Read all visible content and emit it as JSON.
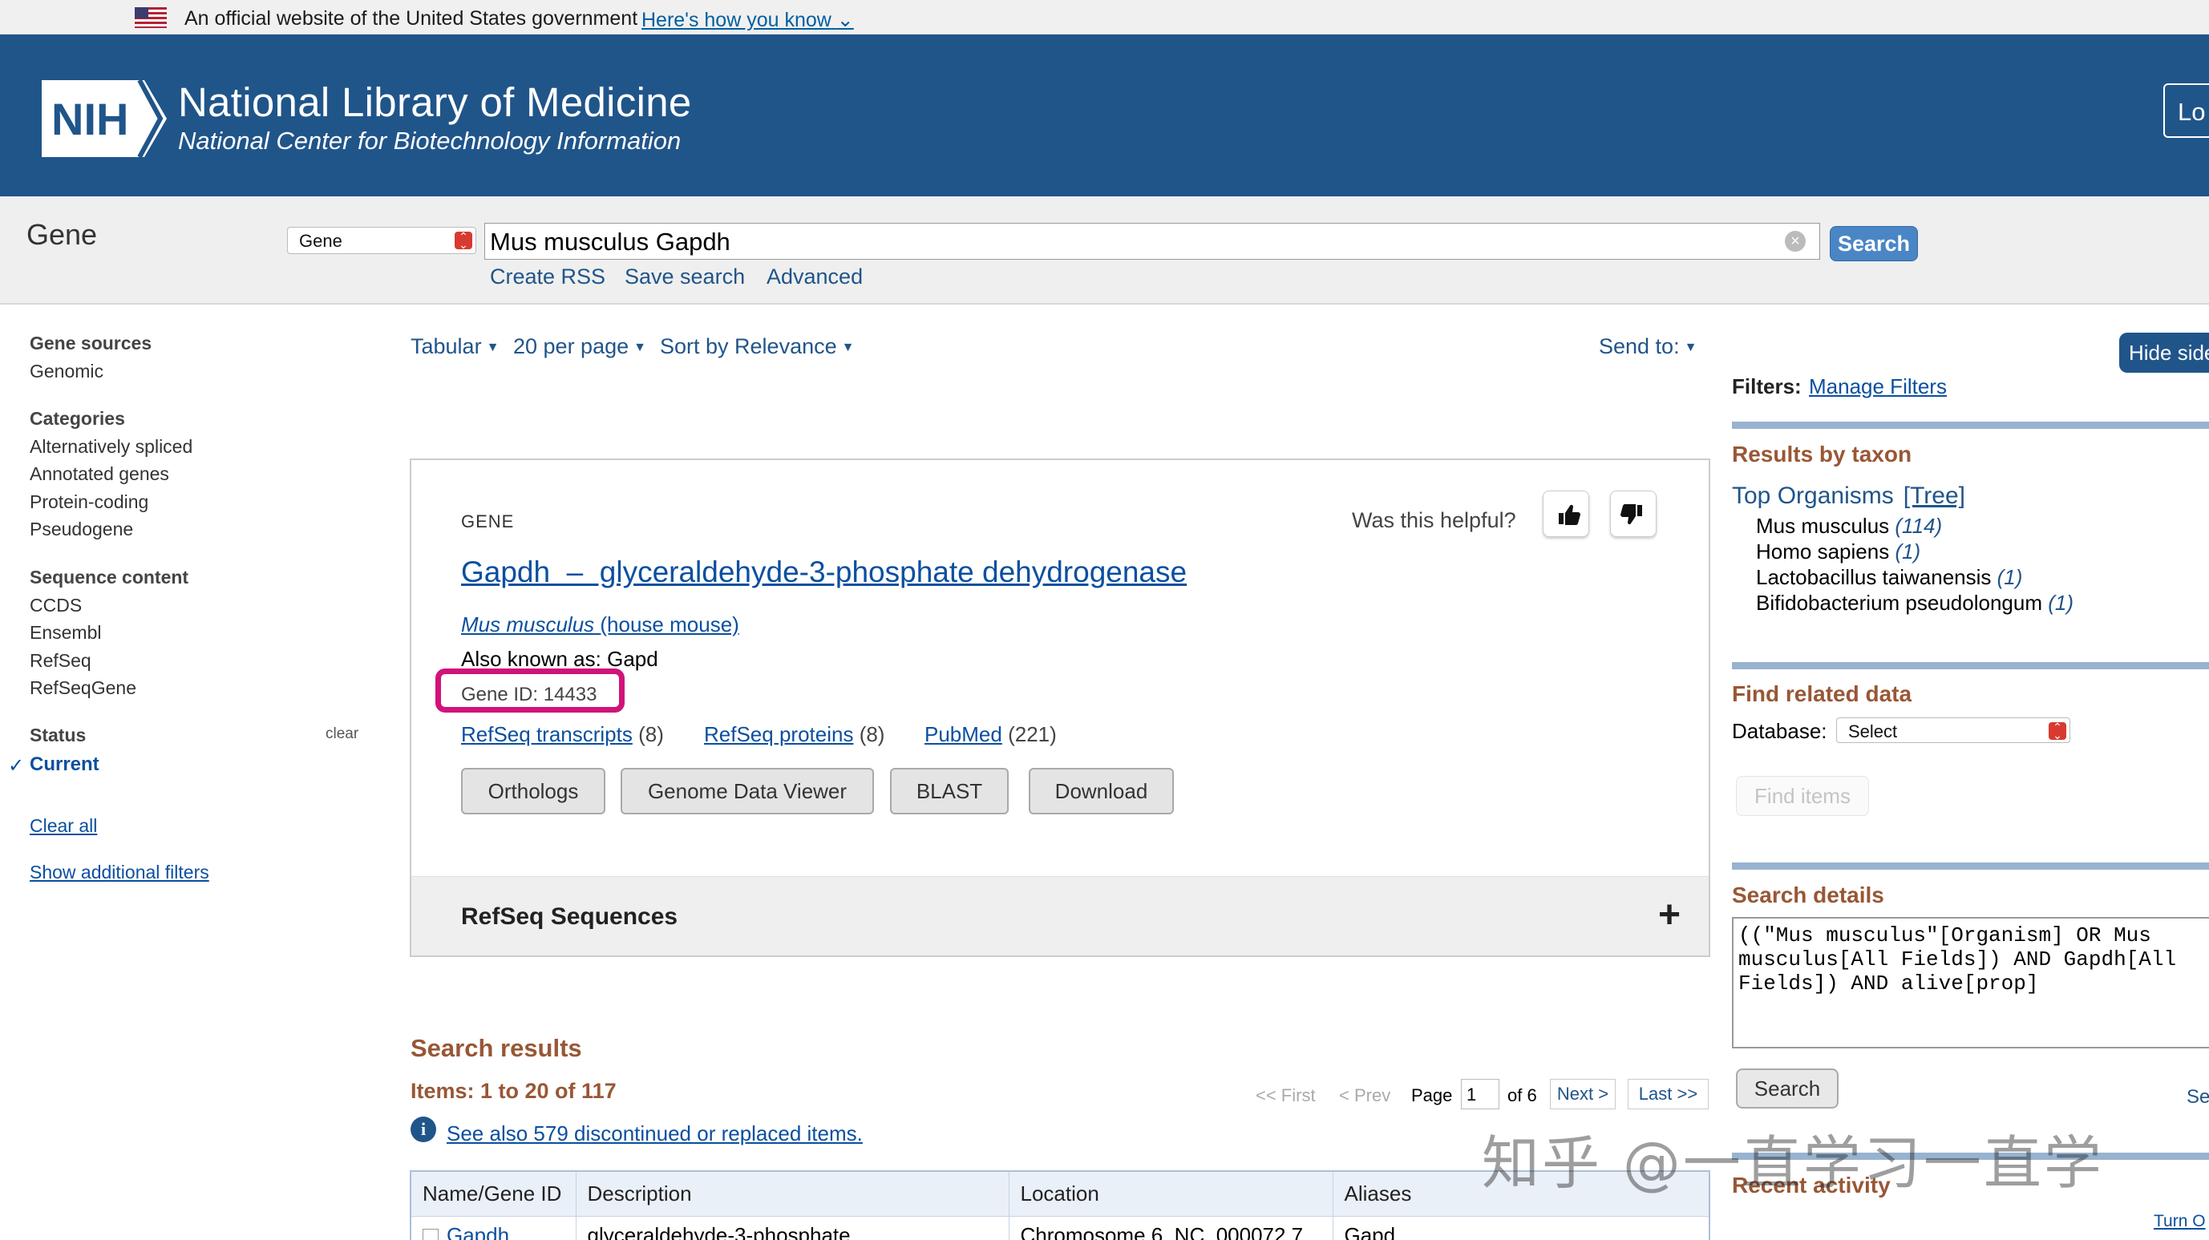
{
  "gov_banner": {
    "text": "An official website of the United States government",
    "link": "Here's how you know"
  },
  "header": {
    "logo": "NIH",
    "title": "National Library of Medicine",
    "subtitle": "National Center for Biotechnology Information",
    "login_label": "Lo"
  },
  "search": {
    "db_label": "Gene",
    "db_selected": "Gene",
    "query": "Mus musculus Gapdh",
    "button": "Search",
    "links": [
      "Create RSS",
      "Save search",
      "Advanced"
    ]
  },
  "display": {
    "format": "Tabular",
    "per_page": "20 per page",
    "sort": "Sort by Relevance",
    "send_to": "Send to:"
  },
  "left_sidebar": {
    "sections": [
      {
        "title": "Gene sources",
        "items": [
          "Genomic"
        ]
      },
      {
        "title": "Categories",
        "items": [
          "Alternatively spliced",
          "Annotated genes",
          "Protein-coding",
          "Pseudogene"
        ]
      },
      {
        "title": "Sequence content",
        "items": [
          "CCDS",
          "Ensembl",
          "RefSeq",
          "RefSeqGene"
        ]
      }
    ],
    "status_title": "Status",
    "status_clear": "clear",
    "status_current": "Current",
    "clear_all": "Clear all",
    "show_additional": "Show additional filters"
  },
  "card": {
    "type": "GENE",
    "helpful": "Was this helpful?",
    "title": "Gapdh  –  glyceraldehyde-3-phosphate dehydrogenase",
    "organism_latin": "Mus musculus",
    "organism_common": "(house mouse)",
    "aka": "Also known as: Gapd",
    "gene_id": "Gene ID: 14433",
    "links": [
      {
        "label": "RefSeq transcripts",
        "count": "(8)"
      },
      {
        "label": "RefSeq proteins",
        "count": "(8)"
      },
      {
        "label": "PubMed",
        "count": "(221)"
      }
    ],
    "buttons": [
      "Orthologs",
      "Genome Data Viewer",
      "BLAST",
      "Download"
    ],
    "refseq_section": "RefSeq Sequences",
    "refseq_toggle": "+"
  },
  "results": {
    "title": "Search results",
    "items": "Items: 1 to 20 of 117",
    "see_also": "See also 579 discontinued or replaced items.",
    "pager": {
      "first": "<< First",
      "prev": "< Prev",
      "page_label": "Page",
      "page_value": "1",
      "of": "of 6",
      "next": "Next >",
      "last": "Last >>"
    },
    "columns": [
      "Name/Gene ID",
      "Description",
      "Location",
      "Aliases"
    ],
    "rows": [
      {
        "name": "Gapdh",
        "description": "glyceraldehyde-3-phosphate",
        "location": "Chromosome 6, NC_000072.7",
        "aliases": "Gapd"
      }
    ]
  },
  "right_sidebar": {
    "hide_label": "Hide side",
    "filters_label": "Filters:",
    "manage_filters": "Manage Filters",
    "taxon_title": "Results by taxon",
    "top_organisms": "Top Organisms",
    "tree": "[Tree]",
    "organisms": [
      {
        "name": "Mus musculus",
        "count": "(114)"
      },
      {
        "name": "Homo sapiens",
        "count": "(1)"
      },
      {
        "name": "Lactobacillus taiwanensis",
        "count": "(1)"
      },
      {
        "name": "Bifidobacterium pseudolongum",
        "count": "(1)"
      }
    ],
    "related_title": "Find related data",
    "database_label": "Database:",
    "database_selected": "Select",
    "find_items": "Find items",
    "details_title": "Search details",
    "details_text": "((\"Mus musculus\"[Organism] OR Mus musculus[All Fields]) AND Gapdh[All Fields]) AND alive[prop]",
    "details_search": "Search",
    "see_more_cut": "Se",
    "recent_title": "Recent activity",
    "turn_off": "Turn O"
  },
  "watermark": "知乎 @一直学习一直学",
  "colors": {
    "header_bg": "#20558a",
    "link": "#0b4fa0",
    "section_heading": "#985735",
    "highlight_box": "#d1137a"
  }
}
